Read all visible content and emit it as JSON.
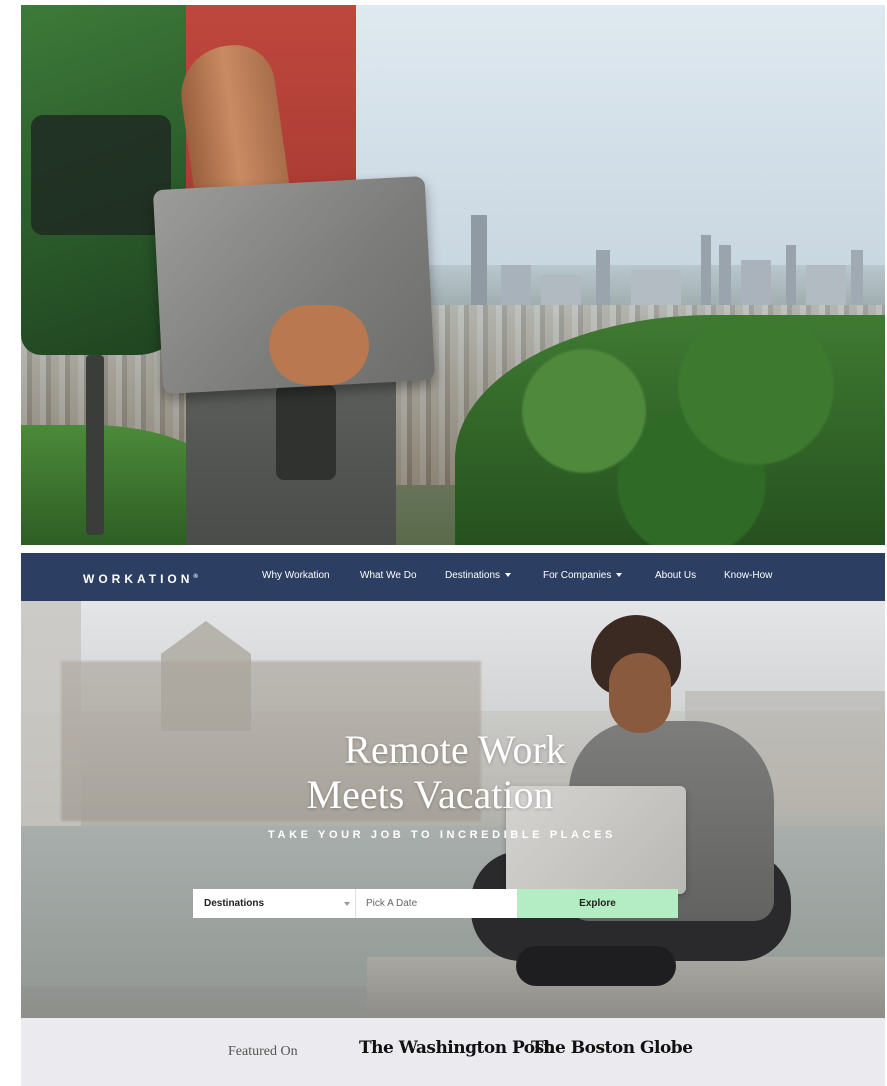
{
  "nav": {
    "brand": "WORKATION",
    "brand_mark": "®",
    "items": [
      {
        "label": "Why Workation",
        "dropdown": false
      },
      {
        "label": "What We Do",
        "dropdown": false
      },
      {
        "label": "Destinations",
        "dropdown": true
      },
      {
        "label": "For Companies",
        "dropdown": true
      },
      {
        "label": "About Us",
        "dropdown": false
      },
      {
        "label": "Know-How",
        "dropdown": false
      }
    ],
    "background_color": "#2c3e62"
  },
  "hero": {
    "title_line1": "Remote Work",
    "title_line2": "Meets Vacation",
    "subtitle": "TAKE YOUR JOB TO INCREDIBLE PLACES"
  },
  "search": {
    "destinations_label": "Destinations",
    "date_placeholder": "Pick A Date",
    "explore_label": "Explore",
    "explore_color": "#b4ecc4"
  },
  "featured": {
    "label": "Featured On",
    "outlets": [
      "The Washington Post",
      "The Boston Globe"
    ]
  }
}
